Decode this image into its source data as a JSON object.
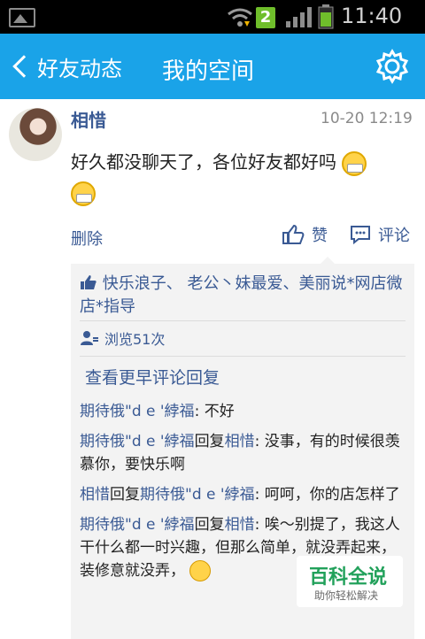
{
  "status_bar": {
    "time": "11:40",
    "sim_label": "2",
    "icons": [
      "picture-icon",
      "wifi-icon",
      "sim-icon",
      "signal-icon",
      "battery-icon"
    ]
  },
  "title_bar": {
    "back_label": "好友动态",
    "title": "我的空间"
  },
  "post": {
    "author": "相惜",
    "time": "10-20 12:19",
    "text": "好久都没聊天了，各位好友都好吗",
    "delete_label": "删除",
    "like_label": "赞",
    "comment_label": "评论"
  },
  "panel": {
    "likes_text": "快乐浪子、 老公丶妹最爱、美丽说*网店微店*指导",
    "views_text": "浏览51次",
    "more_comments": "查看更早评论回复"
  },
  "comments": [
    {
      "from": "期待俄\"d e '綍福",
      "reply_word": "",
      "to": "",
      "text": ": 不好"
    },
    {
      "from": "期待俄\"d e '綍福",
      "reply_word": "回复",
      "to": "相惜",
      "text": ": 没事，有的时候很羡慕你，要快乐啊"
    },
    {
      "from": "相惜",
      "reply_word": "回复",
      "to": "期待俄\"d e '綍福",
      "text": ": 呵呵，你的店怎样了"
    },
    {
      "from": "期待俄\"d e '綍福",
      "reply_word": "回复",
      "to": "相惜",
      "text": ": 唉～别提了，我这人干什么都一时兴趣，但那么简单，就没弄起来，装修意就没弄，"
    }
  ],
  "watermark": {
    "title": "百科全说",
    "subtitle": "助你轻松解决"
  },
  "colors": {
    "title_bar_bg": "#1aa3e8",
    "name_blue": "#3a5a94",
    "timestamp_gray": "#8a8a8a",
    "panel_bg": "#f3f3f3"
  }
}
